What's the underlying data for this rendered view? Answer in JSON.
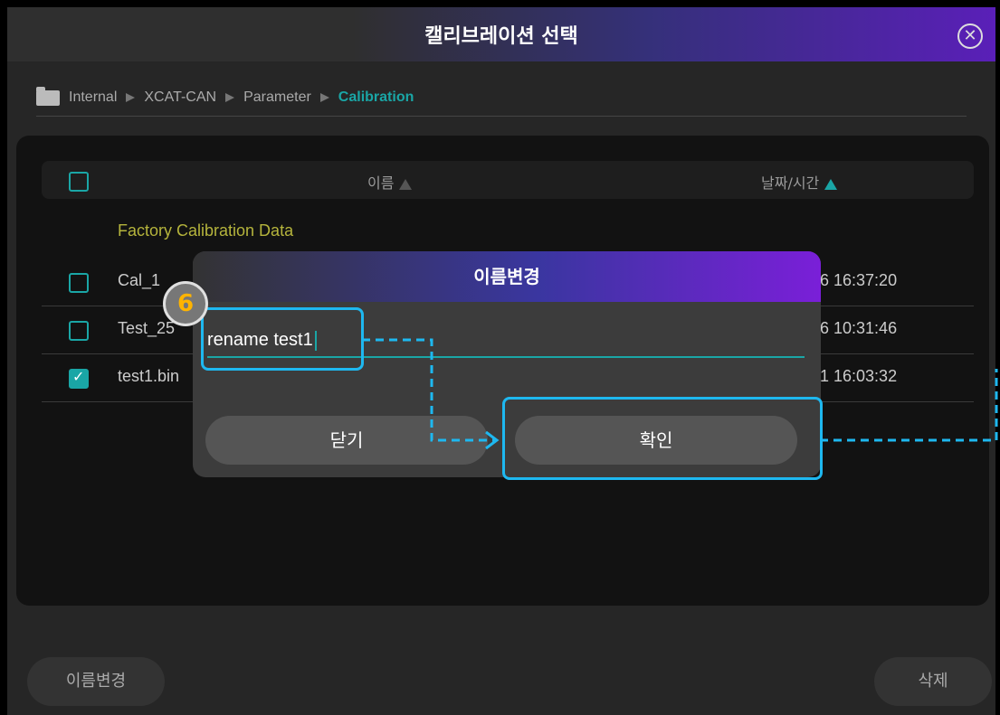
{
  "window": {
    "title": "캘리브레이션 선택",
    "close_icon": "circle-x-icon"
  },
  "breadcrumb": [
    "Internal",
    "XCAT-CAN",
    "Parameter",
    "Calibration"
  ],
  "table": {
    "col_name": "이름",
    "col_date": "날짜/시간",
    "group_title": "Factory Calibration Data",
    "rows": [
      {
        "name": "Cal_1",
        "date": "6 16:37:20",
        "checked": false
      },
      {
        "name": "Test_25",
        "date": "6 10:31:46",
        "checked": false
      },
      {
        "name": "test1.bin",
        "date": "1 16:03:32",
        "checked": true
      }
    ]
  },
  "bottom": {
    "rename_label": "이름변경",
    "delete_label": "삭제"
  },
  "dialog": {
    "title": "이름변경",
    "input_value": "rename test1",
    "cancel_label": "닫기",
    "confirm_label": "확인"
  },
  "annotation": {
    "step_number": "6",
    "highlight_color": "#1eb8f0",
    "badge_color": "#ffb400"
  },
  "colors": {
    "accent": "#1aa6a6",
    "group_title": "#b5b43c"
  }
}
